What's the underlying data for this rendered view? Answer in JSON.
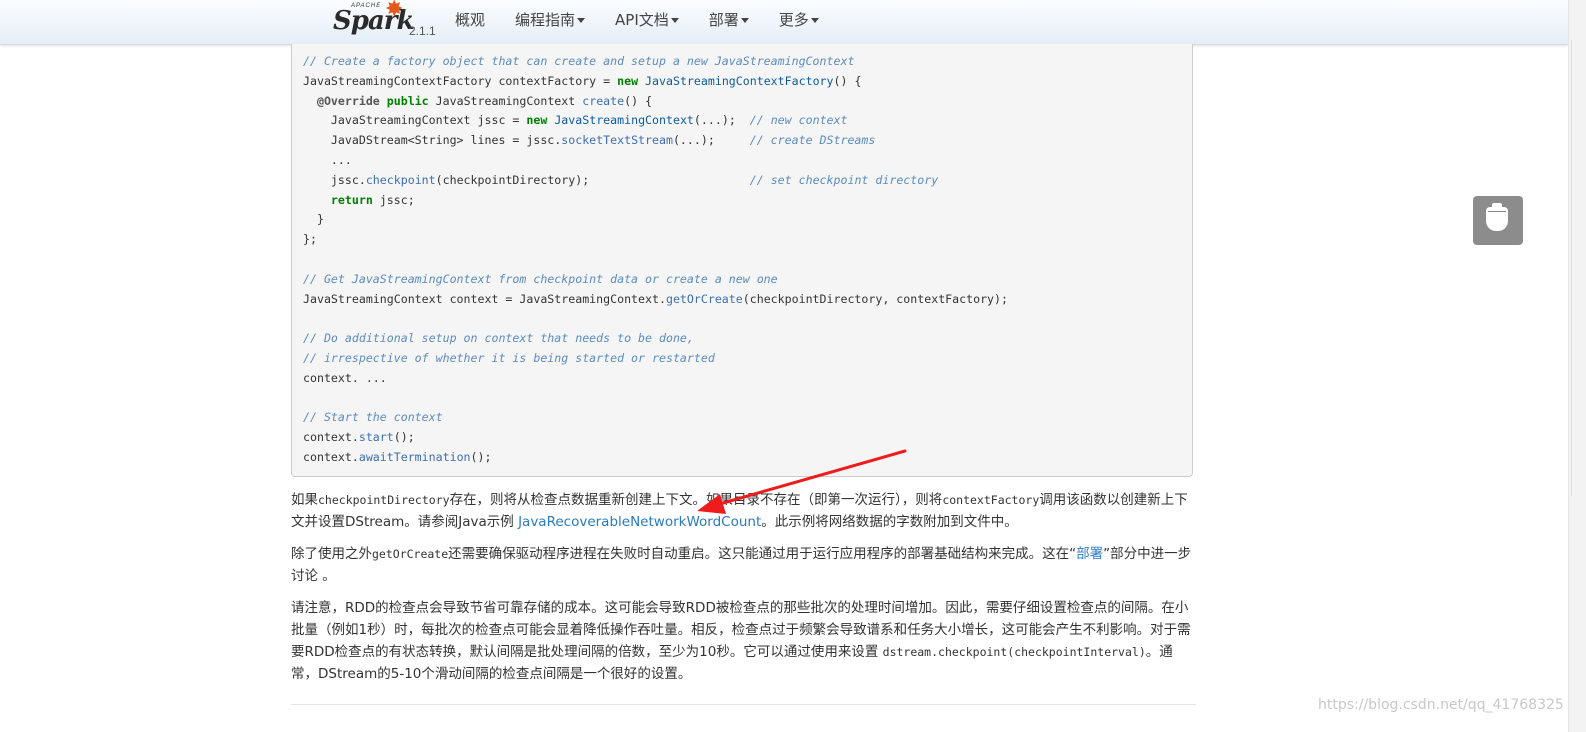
{
  "navbar": {
    "brand_apache": "APACHE",
    "brand_name": "Spark",
    "version": "2.1.1",
    "items": [
      {
        "label": "概观",
        "dropdown": false
      },
      {
        "label": "编程指南",
        "dropdown": true
      },
      {
        "label": "API文档",
        "dropdown": true
      },
      {
        "label": "部署",
        "dropdown": true
      },
      {
        "label": "更多",
        "dropdown": true
      }
    ]
  },
  "code": {
    "lines": [
      [
        {
          "t": "// Create a factory object that can create and setup a new JavaStreamingContext",
          "c": "cm"
        }
      ],
      [
        {
          "t": "JavaStreamingContextFactory contextFactory = "
        },
        {
          "t": "new",
          "c": "kw"
        },
        {
          "t": " "
        },
        {
          "t": "JavaStreamingContextFactory",
          "c": "cn"
        },
        {
          "t": "() {"
        }
      ],
      [
        {
          "t": "  "
        },
        {
          "t": "@Override",
          "c": "an"
        },
        {
          "t": " "
        },
        {
          "t": "public",
          "c": "kw"
        },
        {
          "t": " JavaStreamingContext "
        },
        {
          "t": "create",
          "c": "fn"
        },
        {
          "t": "() {"
        }
      ],
      [
        {
          "t": "    JavaStreamingContext jssc = "
        },
        {
          "t": "new",
          "c": "kw"
        },
        {
          "t": " "
        },
        {
          "t": "JavaStreamingContext",
          "c": "cn"
        },
        {
          "t": "(...);  "
        },
        {
          "t": "// new context",
          "c": "cm"
        }
      ],
      [
        {
          "t": "    JavaDStream<String> lines = jssc."
        },
        {
          "t": "socketTextStream",
          "c": "fn"
        },
        {
          "t": "(...);     "
        },
        {
          "t": "// create DStreams",
          "c": "cm"
        }
      ],
      [
        {
          "t": "    ..."
        }
      ],
      [
        {
          "t": "    jssc."
        },
        {
          "t": "checkpoint",
          "c": "fn"
        },
        {
          "t": "(checkpointDirectory);                       "
        },
        {
          "t": "// set checkpoint directory",
          "c": "cm"
        }
      ],
      [
        {
          "t": "    "
        },
        {
          "t": "return",
          "c": "kw"
        },
        {
          "t": " jssc;"
        }
      ],
      [
        {
          "t": "  }"
        }
      ],
      [
        {
          "t": "};"
        }
      ],
      [
        {
          "t": ""
        }
      ],
      [
        {
          "t": "// Get JavaStreamingContext from checkpoint data or create a new one",
          "c": "cm"
        }
      ],
      [
        {
          "t": "JavaStreamingContext context = JavaStreamingContext."
        },
        {
          "t": "getOrCreate",
          "c": "fn"
        },
        {
          "t": "(checkpointDirectory, contextFactory);"
        }
      ],
      [
        {
          "t": ""
        }
      ],
      [
        {
          "t": "// Do additional setup on context that needs to be done,",
          "c": "cm"
        }
      ],
      [
        {
          "t": "// irrespective of whether it is being started or restarted",
          "c": "cm"
        }
      ],
      [
        {
          "t": "context. ..."
        }
      ],
      [
        {
          "t": ""
        }
      ],
      [
        {
          "t": "// Start the context",
          "c": "cm"
        }
      ],
      [
        {
          "t": "context."
        },
        {
          "t": "start",
          "c": "fn"
        },
        {
          "t": "();"
        }
      ],
      [
        {
          "t": "context."
        },
        {
          "t": "awaitTermination",
          "c": "fn"
        },
        {
          "t": "();"
        }
      ]
    ]
  },
  "paragraphs": {
    "p1": {
      "a": "如果",
      "code1": "checkpointDirectory",
      "b": "存在，则将从检查点数据重新创建上下文。如果目录不存在（即第一次运行），则将",
      "code2": "contextFactory",
      "c": "调用该函数以创建新上下文并设置DStream。请参阅Java示例 ",
      "link": "JavaRecoverableNetworkWordCount",
      "d": "。此示例将网络数据的字数附加到文件中。"
    },
    "p2": {
      "a": "除了使用之外",
      "code1": "getOrCreate",
      "b": "还需要确保驱动程序进程在失败时自动重启。这只能通过用于运行应用程序的部署基础结构来完成。这在“",
      "link": "部署",
      "c": "”部分中进一步讨论 。"
    },
    "p3": {
      "a": "请注意，RDD的检查点会导致节省可靠存储的成本。这可能会导致RDD被检查点的那些批次的处理时间增加。因此，需要仔细设置检查点的间隔。在小批量（例如1秒）时，每批次的检查点可能会显着降低操作吞吐量。相反，检查点过于频繁会导致谱系和任务大小增长，这可能会产生不利影响。对于需要RDD检查点的有状态转换，默认间隔是批处理间隔的倍数，至少为10秒。它可以通过使用来设置 ",
      "code1": "dstream.checkpoint(checkpointInterval)",
      "b": "。通常，DStream的5-10个滑动间隔的检查点间隔是一个很好的设置。"
    }
  },
  "watermark": "https://blog.csdn.net/qq_41768325",
  "annotation_arrow_color": "#ee1c1c",
  "float_button_icon": "cup-icon"
}
